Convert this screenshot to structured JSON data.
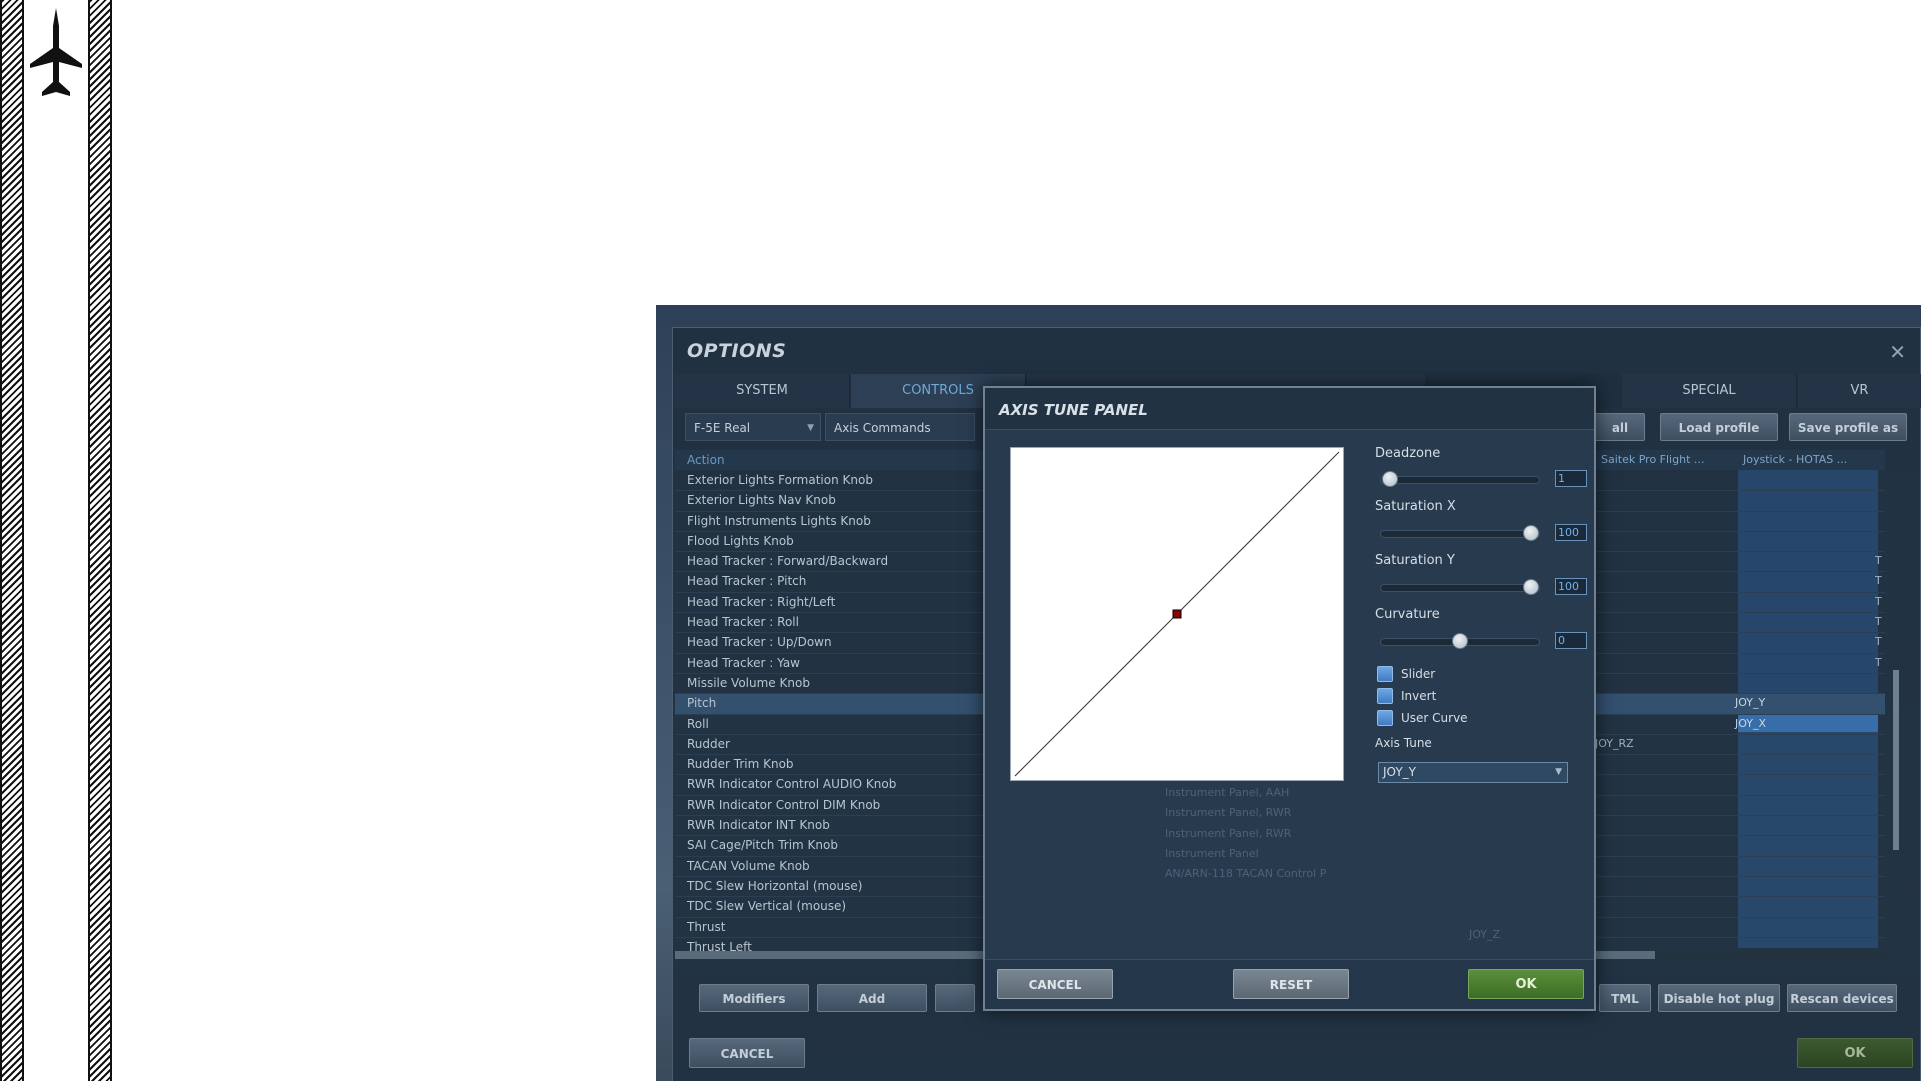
{
  "options": {
    "title": "OPTIONS",
    "close_glyph": "✕",
    "tabs": [
      {
        "label": "SYSTEM"
      },
      {
        "label": "CONTROLS"
      },
      {
        "label": "SPECIAL"
      },
      {
        "label": "VR"
      }
    ],
    "aircraft_select": "F-5E Real",
    "category_select": "Axis Commands",
    "btn_all": "all",
    "btn_load_profile": "Load profile",
    "btn_save_profile": "Save profile as",
    "action_header": "Action",
    "device_headers": [
      "Saitek Pro Flight ...",
      "Joystick - HOTAS ..."
    ],
    "rows": [
      {
        "label": "Exterior Lights Formation Knob",
        "rz": "",
        "joy": "",
        "t": ""
      },
      {
        "label": "Exterior Lights Nav Knob",
        "rz": "",
        "joy": "",
        "t": ""
      },
      {
        "label": "Flight Instruments Lights Knob",
        "rz": "",
        "joy": "",
        "t": ""
      },
      {
        "label": "Flood Lights Knob",
        "rz": "",
        "joy": "",
        "t": ""
      },
      {
        "label": "Head Tracker : Forward/Backward",
        "rz": "",
        "joy": "",
        "t": "T"
      },
      {
        "label": "Head Tracker : Pitch",
        "rz": "",
        "joy": "",
        "t": "T"
      },
      {
        "label": "Head Tracker : Right/Left",
        "rz": "",
        "joy": "",
        "t": "T"
      },
      {
        "label": "Head Tracker : Roll",
        "rz": "",
        "joy": "",
        "t": "T"
      },
      {
        "label": "Head Tracker : Up/Down",
        "rz": "",
        "joy": "",
        "t": "T"
      },
      {
        "label": "Head Tracker : Yaw",
        "rz": "",
        "joy": "",
        "t": "T"
      },
      {
        "label": "Missile Volume Knob",
        "rz": "",
        "joy": "",
        "t": ""
      },
      {
        "label": "Pitch",
        "rz": "",
        "joy": "JOY_Y",
        "t": ""
      },
      {
        "label": "Roll",
        "rz": "",
        "joy": "JOY_X",
        "t": ""
      },
      {
        "label": "Rudder",
        "rz": "JOY_RZ",
        "joy": "",
        "t": ""
      },
      {
        "label": "Rudder Trim Knob",
        "rz": "",
        "joy": "",
        "t": ""
      },
      {
        "label": "RWR Indicator Control AUDIO Knob",
        "rz": "",
        "joy": "",
        "t": ""
      },
      {
        "label": "RWR Indicator Control DIM Knob",
        "rz": "",
        "joy": "",
        "t": ""
      },
      {
        "label": "RWR Indicator INT Knob",
        "rz": "",
        "joy": "",
        "t": ""
      },
      {
        "label": "SAI Cage/Pitch Trim Knob",
        "rz": "",
        "joy": "",
        "t": ""
      },
      {
        "label": "TACAN Volume Knob",
        "rz": "",
        "joy": "",
        "t": ""
      },
      {
        "label": "TDC Slew Horizontal (mouse)",
        "rz": "",
        "joy": "",
        "t": ""
      },
      {
        "label": "TDC Slew Vertical (mouse)",
        "rz": "",
        "joy": "",
        "t": ""
      },
      {
        "label": "Thrust",
        "rz": "",
        "joy": "",
        "t": ""
      },
      {
        "label": "Thrust Left",
        "rz": "",
        "joy": "",
        "t": ""
      }
    ],
    "bottom_buttons": {
      "modifiers": "Modifiers",
      "add": "Add",
      "html": "TML",
      "disable_hot_plug": "Disable hot plug",
      "rescan_devices": "Rescan devices"
    },
    "cancel": "CANCEL",
    "ok": "OK"
  },
  "axis_tune": {
    "title": "AXIS TUNE PANEL",
    "deadzone_label": "Deadzone",
    "deadzone_value": "1",
    "deadzone_level": 0.01,
    "saturation_x_label": "Saturation X",
    "saturation_x_value": "100",
    "saturation_x_level": 1.0,
    "saturation_y_label": "Saturation Y",
    "saturation_y_value": "100",
    "saturation_y_level": 1.0,
    "curvature_label": "Curvature",
    "curvature_value": "0",
    "curvature_level": 0.5,
    "checkboxes": [
      {
        "label": "Slider",
        "checked": false
      },
      {
        "label": "Invert",
        "checked": false
      },
      {
        "label": "User Curve",
        "checked": false
      }
    ],
    "axis_tune_label": "Axis Tune",
    "axis_select": "JOY_Y",
    "ghost_rows": [
      "Instrument Panel, AAH",
      "Instrument Panel, RWR",
      "Instrument Panel, RWR",
      "Instrument Panel",
      "AN/ARN-118 TACAN Control P"
    ],
    "ghost_joy": "JOY_Z",
    "cancel": "CANCEL",
    "reset": "RESET",
    "ok": "OK"
  },
  "colors": {
    "accent_blue": "#6fa9d6",
    "ok_green": "#4f8a30",
    "curve_point": "#8b0000"
  },
  "icons": {
    "plane": "fighter-jet-silhouette-icon"
  }
}
